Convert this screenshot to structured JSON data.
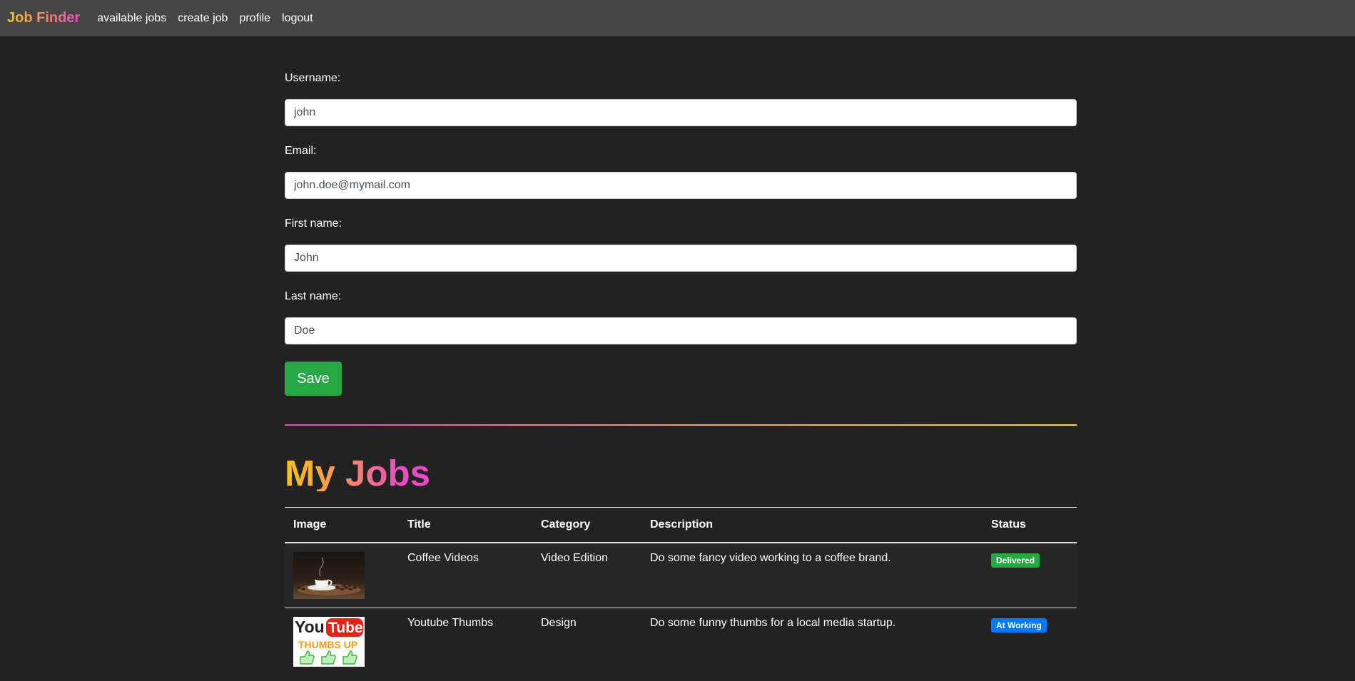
{
  "navbar": {
    "brand": "Job Finder",
    "links": [
      "available jobs",
      "create job",
      "profile",
      "logout"
    ]
  },
  "form": {
    "username_label": "Username:",
    "username_value": "john",
    "email_label": "Email:",
    "email_value": "john.doe@mymail.com",
    "first_name_label": "First name:",
    "first_name_value": "John",
    "last_name_label": "Last name:",
    "last_name_value": "Doe",
    "save_label": "Save"
  },
  "jobs": {
    "title": "My Jobs",
    "columns": [
      "Image",
      "Title",
      "Category",
      "Description",
      "Status"
    ],
    "rows": [
      {
        "image": "coffee-cup-image",
        "title": "Coffee Videos",
        "category": "Video Edition",
        "description": "Do some fancy video working to a coffee brand.",
        "status": "Delivered",
        "status_color": "#28a745"
      },
      {
        "image": "youtube-thumbs-up-image",
        "image_text_1": "You",
        "image_text_2": "Tube",
        "image_text_3": "THUMBS UP",
        "title": "Youtube Thumbs",
        "category": "Design",
        "description": "Do some funny thumbs for a local media startup.",
        "status": "At Working",
        "status_color": "#007bff"
      }
    ]
  },
  "colors": {
    "background": "#222222",
    "navbar": "#464646",
    "save_button": "#28a745"
  }
}
